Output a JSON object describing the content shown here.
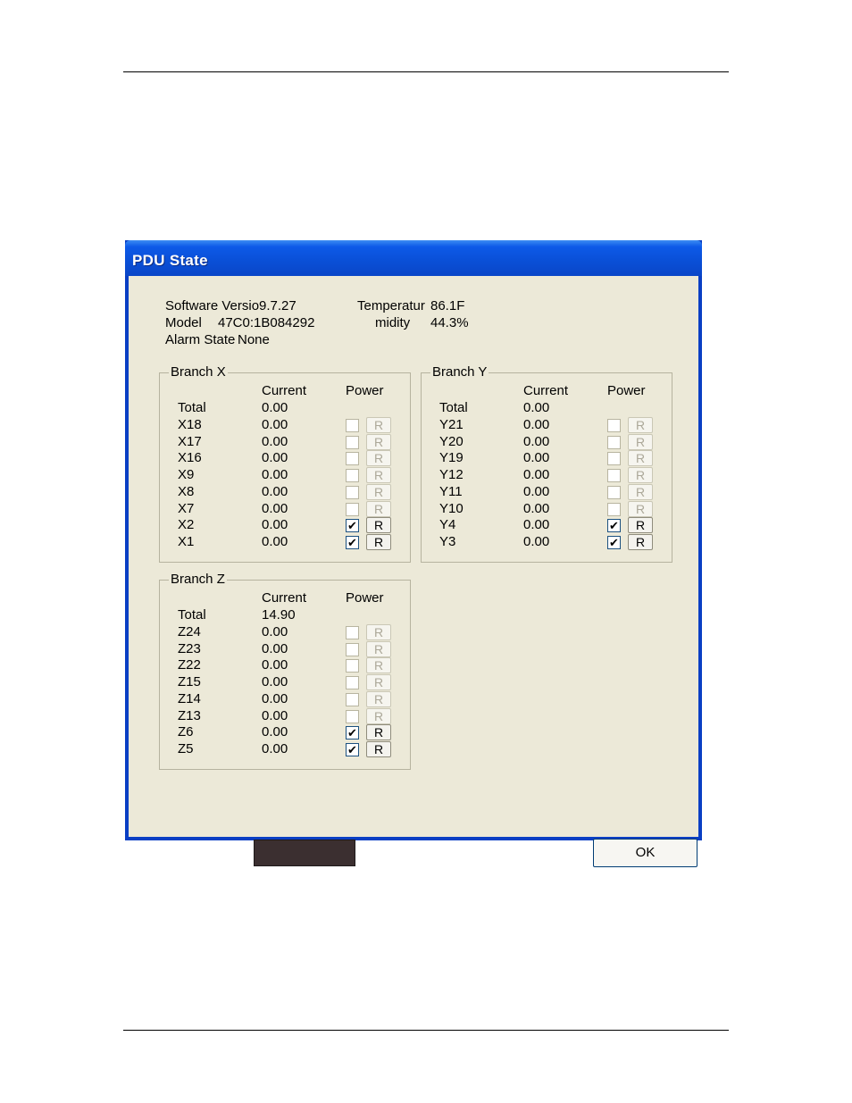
{
  "window": {
    "title": "PDU State"
  },
  "info": {
    "software_label": "Software Versio",
    "software_value": "9.7.27",
    "model_label": "Model",
    "model_value": "47C0:1B084292",
    "alarm_label": "Alarm State",
    "alarm_value": "None",
    "temp_label": "Temperatur",
    "temp_value": "86.1F",
    "humidity_label": "midity",
    "humidity_value": "44.3%"
  },
  "headers": {
    "current": "Current",
    "power": "Power",
    "reset": "R"
  },
  "branch_x": {
    "title": "Branch X",
    "total_label": "Total",
    "total_value": "0.00",
    "rows": [
      {
        "label": "X18",
        "value": "0.00",
        "checked": false,
        "enabled": false
      },
      {
        "label": "X17",
        "value": "0.00",
        "checked": false,
        "enabled": false
      },
      {
        "label": "X16",
        "value": "0.00",
        "checked": false,
        "enabled": false
      },
      {
        "label": "X9",
        "value": "0.00",
        "checked": false,
        "enabled": false
      },
      {
        "label": "X8",
        "value": "0.00",
        "checked": false,
        "enabled": false
      },
      {
        "label": "X7",
        "value": "0.00",
        "checked": false,
        "enabled": false
      },
      {
        "label": "X2",
        "value": "0.00",
        "checked": true,
        "enabled": true
      },
      {
        "label": "X1",
        "value": "0.00",
        "checked": true,
        "enabled": true
      }
    ]
  },
  "branch_y": {
    "title": "Branch Y",
    "total_label": "Total",
    "total_value": "0.00",
    "rows": [
      {
        "label": "Y21",
        "value": "0.00",
        "checked": false,
        "enabled": false
      },
      {
        "label": "Y20",
        "value": "0.00",
        "checked": false,
        "enabled": false
      },
      {
        "label": "Y19",
        "value": "0.00",
        "checked": false,
        "enabled": false
      },
      {
        "label": "Y12",
        "value": "0.00",
        "checked": false,
        "enabled": false
      },
      {
        "label": "Y11",
        "value": "0.00",
        "checked": false,
        "enabled": false
      },
      {
        "label": "Y10",
        "value": "0.00",
        "checked": false,
        "enabled": false
      },
      {
        "label": "Y4",
        "value": "0.00",
        "checked": true,
        "enabled": true
      },
      {
        "label": "Y3",
        "value": "0.00",
        "checked": true,
        "enabled": true
      }
    ]
  },
  "branch_z": {
    "title": "Branch Z",
    "total_label": "Total",
    "total_value": "14.90",
    "rows": [
      {
        "label": "Z24",
        "value": "0.00",
        "checked": false,
        "enabled": false
      },
      {
        "label": "Z23",
        "value": "0.00",
        "checked": false,
        "enabled": false
      },
      {
        "label": "Z22",
        "value": "0.00",
        "checked": false,
        "enabled": false
      },
      {
        "label": "Z15",
        "value": "0.00",
        "checked": false,
        "enabled": false
      },
      {
        "label": "Z14",
        "value": "0.00",
        "checked": false,
        "enabled": false
      },
      {
        "label": "Z13",
        "value": "0.00",
        "checked": false,
        "enabled": false
      },
      {
        "label": "Z6",
        "value": "0.00",
        "checked": true,
        "enabled": true
      },
      {
        "label": "Z5",
        "value": "0.00",
        "checked": true,
        "enabled": true
      }
    ]
  },
  "buttons": {
    "ok_label": "OK"
  },
  "colors": {
    "dialog_bg": "#ece9d8",
    "titlebar": "#0a4fd6",
    "dark_button": "#3b2f30"
  }
}
